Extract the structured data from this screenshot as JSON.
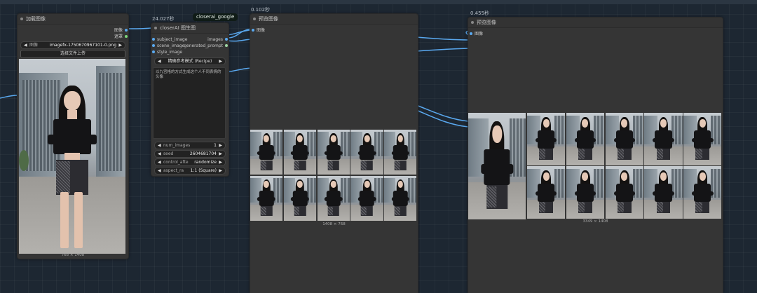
{
  "load_node": {
    "title": "加载图像",
    "outputs": [
      "图像",
      "遮罩"
    ],
    "image_widget": {
      "label": "图像",
      "value": "imagefx-1750670967101-0.png"
    },
    "upload_button": "选择文件上传",
    "dimensions": "768 × 1408"
  },
  "closerai_node": {
    "time": "24.027秒",
    "badge": "closerai_google",
    "title": "closerAI 图生图",
    "inputs": [
      "subject_image",
      "scene_image",
      "style_image"
    ],
    "outputs": [
      "images",
      "generated_prompt"
    ],
    "mode_select": "精确参考模式 (Recipe)",
    "prompt_text": "以九宫格的方式生成这个人不同表情的头像",
    "widgets": [
      {
        "label": "num_images",
        "value": "1"
      },
      {
        "label": "seed",
        "value": "2604681704"
      },
      {
        "label": "control_afte",
        "value": "randomize"
      },
      {
        "label": "aspect_ra",
        "value": "1:1 (Square)"
      }
    ]
  },
  "preview1": {
    "time": "0.102秒",
    "title": "预览图像",
    "input": "图像",
    "dimensions": "1408 × 768"
  },
  "preview2": {
    "time": "0.455秒",
    "title": "预览图像",
    "input": "图像",
    "dimensions": "3349 × 1408"
  },
  "colors": {
    "canvas": "#1d2732",
    "node": "#353535",
    "link_blue": "#5aa9f0",
    "badge": "#101c17"
  }
}
